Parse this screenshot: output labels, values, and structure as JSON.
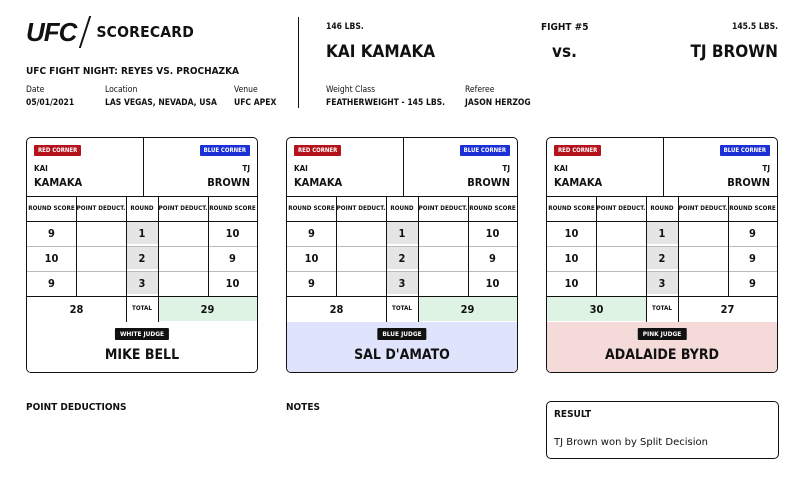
{
  "header": {
    "logo_ufc": "UFC",
    "logo_scorecard": "SCORECARD",
    "event": "UFC FIGHT NIGHT: REYES VS. PROCHAZKA",
    "date_label": "Date",
    "date": "05/01/2021",
    "location_label": "Location",
    "location": "LAS VEGAS, NEVADA, USA",
    "venue_label": "Venue",
    "venue": "UFC APEX"
  },
  "bout": {
    "fighter1_weight": "146 LBS.",
    "fighter1_name": "KAI KAMAKA",
    "fight_number": "FIGHT #5",
    "vs": "vs.",
    "fighter2_weight": "145.5 LBS.",
    "fighter2_name": "TJ BROWN",
    "weight_class_label": "Weight Class",
    "weight_class": "FEATHERWEIGHT - 145 LBS.",
    "referee_label": "Referee",
    "referee": "JASON HERZOG"
  },
  "labels": {
    "red_corner": "RED CORNER",
    "blue_corner": "BLUE CORNER",
    "red_first": "KAI",
    "red_last": "KAMAKA",
    "blue_first": "TJ",
    "blue_last": "BROWN",
    "round_score": "ROUND SCORE",
    "point_deduct": "POINT DEDUCT.",
    "round": "ROUND",
    "total": "TOTAL"
  },
  "cards": [
    {
      "judge_label": "WHITE JUDGE",
      "judge_name": "MIKE BELL",
      "judge_color": "#ffffff",
      "rounds": [
        {
          "r": "1",
          "red": "9",
          "blue": "10"
        },
        {
          "r": "2",
          "red": "10",
          "blue": "9"
        },
        {
          "r": "3",
          "red": "9",
          "blue": "10"
        }
      ],
      "red_total": "28",
      "blue_total": "29",
      "winner": "blue"
    },
    {
      "judge_label": "BLUE JUDGE",
      "judge_name": "SAL D'AMATO",
      "judge_color": "#dfe3fb",
      "rounds": [
        {
          "r": "1",
          "red": "9",
          "blue": "10"
        },
        {
          "r": "2",
          "red": "10",
          "blue": "9"
        },
        {
          "r": "3",
          "red": "9",
          "blue": "10"
        }
      ],
      "red_total": "28",
      "blue_total": "29",
      "winner": "blue"
    },
    {
      "judge_label": "PINK JUDGE",
      "judge_name": "ADALAIDE BYRD",
      "judge_color": "#f5dada",
      "rounds": [
        {
          "r": "1",
          "red": "10",
          "blue": "9"
        },
        {
          "r": "2",
          "red": "10",
          "blue": "9"
        },
        {
          "r": "3",
          "red": "10",
          "blue": "9"
        }
      ],
      "red_total": "30",
      "blue_total": "27",
      "winner": "red"
    }
  ],
  "footer": {
    "point_deductions": "POINT DEDUCTIONS",
    "notes": "NOTES",
    "result_title": "RESULT",
    "result_text": "TJ Brown won by Split Decision"
  }
}
